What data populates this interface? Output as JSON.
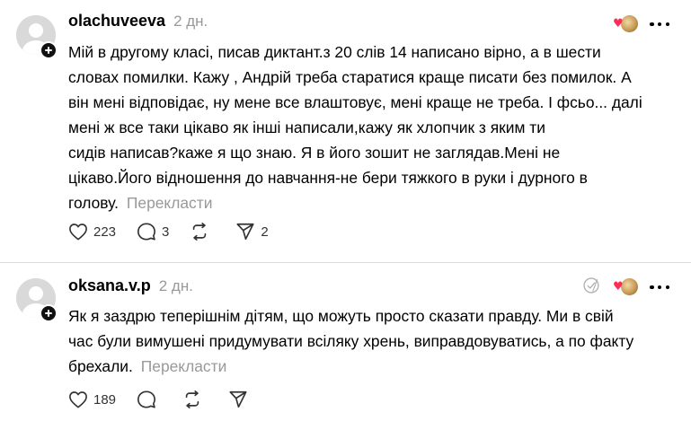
{
  "colors": {
    "text": "#000000",
    "muted": "#999999",
    "heart": "#ff2d55",
    "divider": "#dcdcdc"
  },
  "comments": [
    {
      "username": "olachuveeva",
      "time": "2 дн.",
      "text_lines": [
        "Мій в другому класі, писав диктант.з 20 слів 14 написано вірно, а в шести",
        "словах помилки. Кажу , Андрій треба старатися краще писати без помилок. А",
        "він мені відповідає, ну мене все влаштовує, мені краще не треба. І фсьо... далі",
        "мені ж все таки цікаво як інші написали,кажу як хлопчик з яким ти",
        "сидів написав?каже я що знаю. Я в його зошит не заглядав.Мені не",
        "цікаво.Його відношення до навчання-не бери тяжкого в руки і дурного в",
        "голову."
      ],
      "translate_label": "Перекласти",
      "likes": "223",
      "replies": "3",
      "reposts": "",
      "shares": "2",
      "icons": [
        "avatar-icon",
        "follow-plus-icon",
        "heart-icon",
        "comment-icon",
        "repost-icon",
        "send-icon",
        "more-icon"
      ]
    },
    {
      "username": "oksana.v.p",
      "time": "2 дн.",
      "text_lines": [
        "Як я заздрю теперішнім дітям, що можуть просто сказати правду. Ми в свій",
        "час були вимушені придумувати всіляку хрень, виправдовуватись, а по факту",
        "брехали."
      ],
      "translate_label": "Перекласти",
      "likes": "189",
      "replies": "",
      "reposts": "",
      "shares": "",
      "icons": [
        "avatar-icon",
        "follow-plus-icon",
        "author-liked-icon",
        "heart-icon",
        "comment-icon",
        "repost-icon",
        "send-icon",
        "more-icon"
      ]
    }
  ]
}
